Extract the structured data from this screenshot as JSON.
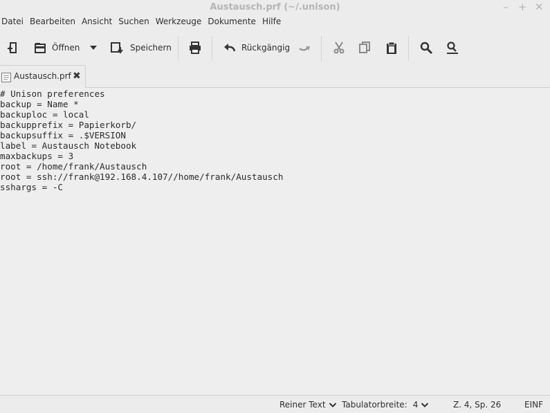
{
  "window": {
    "title": "Austausch.prf (~/.unison)",
    "minimize": "–",
    "maximize": "+",
    "close": "✕"
  },
  "menu": [
    "Datei",
    "Bearbeiten",
    "Ansicht",
    "Suchen",
    "Werkzeuge",
    "Dokumente",
    "Hilfe"
  ],
  "toolbar": {
    "open_label": "Öffnen",
    "save_label": "Speichern",
    "undo_label": "Rückgängig"
  },
  "tab": {
    "label": "Austausch.prf",
    "close": "✖"
  },
  "editor": {
    "lines": [
      "# Unison preferences",
      "backup = Name *",
      "backuploc = local",
      "backupprefix = Papierkorb/",
      "backupsuffix = .$VERSION",
      "label = Austausch Notebook",
      "maxbackups = 3",
      "root = /home/frank/Austausch",
      "root = ssh://frank@192.168.4.107//home/frank/Austausch",
      "sshargs = -C"
    ]
  },
  "status": {
    "language": "Reiner Text",
    "tab_width_label": "Tabulatorbreite:",
    "tab_width_value": "4",
    "position": "Z. 4, Sp. 26",
    "mode": "EINF"
  }
}
